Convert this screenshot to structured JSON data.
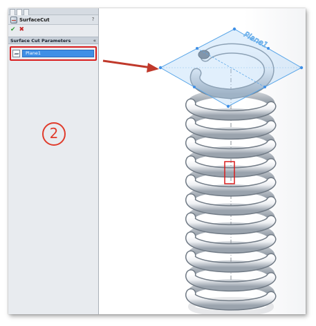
{
  "panel": {
    "title": "SurfaceCut",
    "help_label": "?",
    "ok_label": "✔",
    "cancel_label": "✖",
    "group_title": "Surface Cut Parameters",
    "collapse_label": "«",
    "selection_value": "Plane1"
  },
  "annotation": {
    "step_number": "2"
  },
  "viewport": {
    "plane_label": "Plane1"
  },
  "colors": {
    "highlight_red": "#d91c1c",
    "selection_blue": "#3f8fe6",
    "plane_blue": "#5aa6e8",
    "arrow": "#c0392b"
  }
}
